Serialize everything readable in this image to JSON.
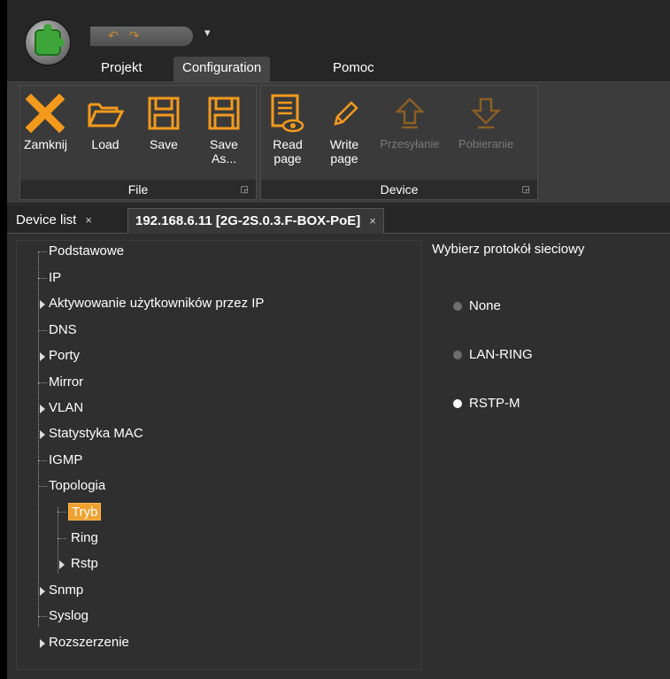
{
  "quick_access": {
    "undo_icon": "undo-arrow-icon",
    "redo_icon": "redo-arrow-icon",
    "menu_glyph": "▾"
  },
  "ribbon_tabs": [
    {
      "label": "Projekt",
      "active": false
    },
    {
      "label": "Configuration",
      "active": true
    },
    {
      "label": "Pomoc",
      "active": false
    }
  ],
  "ribbon": {
    "file_group": {
      "label": "File",
      "buttons": [
        {
          "label": "Zamknij",
          "icon": "close-x-icon"
        },
        {
          "label": "Load",
          "icon": "folder-open-icon"
        },
        {
          "label": "Save",
          "icon": "floppy-disk-icon"
        },
        {
          "label": "Save\nAs...",
          "icon": "floppy-disk-icon"
        }
      ]
    },
    "device_group": {
      "label": "Device",
      "buttons": [
        {
          "label": "Read\npage",
          "icon": "read-page-icon",
          "enabled": true
        },
        {
          "label": "Write\npage",
          "icon": "pencil-icon",
          "enabled": true
        },
        {
          "label": "Przesyłanie",
          "icon": "upload-arrow-icon",
          "enabled": false
        },
        {
          "label": "Pobieranie",
          "icon": "download-arrow-icon",
          "enabled": false
        }
      ]
    }
  },
  "doc_tabs": [
    {
      "label": "Device list",
      "close": "×",
      "active": false
    },
    {
      "label": "192.168.6.11 [2G-2S.0.3.F-BOX-PoE]",
      "close": "×",
      "active": true
    }
  ],
  "tree": {
    "items": [
      "Podstawowe",
      "IP",
      "Aktywowanie użytkowników przez IP",
      "DNS",
      "Porty",
      "Mirror",
      "VLAN",
      "Statystyka MAC",
      "IGMP",
      "Topologia"
    ],
    "children": [
      "Tryb",
      "Ring",
      "Rstp"
    ],
    "after": [
      "Snmp",
      "Syslog",
      "Rozszerzenie"
    ]
  },
  "protocol": {
    "title": "Wybierz protokół sieciowy",
    "options": [
      {
        "label": "None",
        "selected": false
      },
      {
        "label": "LAN-RING",
        "selected": false
      },
      {
        "label": "RSTP-M",
        "selected": true
      }
    ]
  },
  "colors": {
    "accent": "#f0a130",
    "background": "#2f2f2f"
  }
}
